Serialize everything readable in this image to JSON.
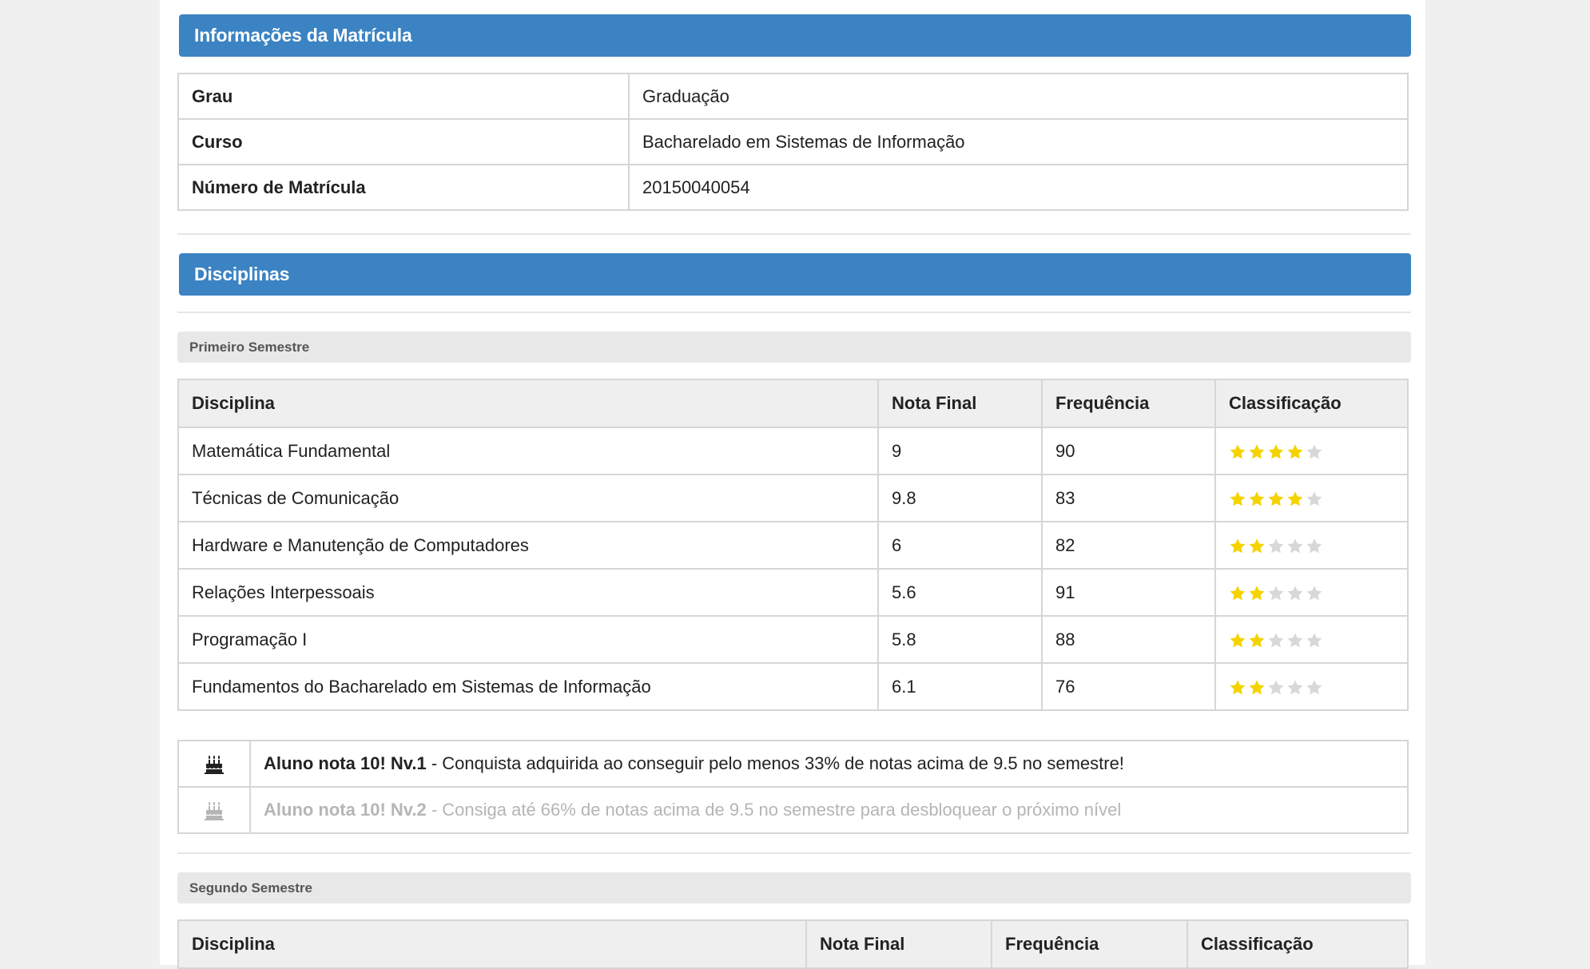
{
  "enrollment": {
    "title": "Informações da Matrícula",
    "rows": [
      {
        "label": "Grau",
        "value": "Graduação"
      },
      {
        "label": "Curso",
        "value": "Bacharelado em Sistemas de Informação"
      },
      {
        "label": "Número de Matrícula",
        "value": "20150040054"
      }
    ]
  },
  "disciplines": {
    "title": "Disciplinas",
    "columns": [
      "Disciplina",
      "Nota Final",
      "Frequência",
      "Classificação"
    ],
    "semesters": [
      {
        "label": "Primeiro Semestre",
        "rows": [
          {
            "name": "Matemática Fundamental",
            "grade": "9",
            "attendance": "90",
            "stars": 4
          },
          {
            "name": "Técnicas de Comunicação",
            "grade": "9.8",
            "attendance": "83",
            "stars": 4
          },
          {
            "name": "Hardware e Manutenção de Computadores",
            "grade": "6",
            "attendance": "82",
            "stars": 2
          },
          {
            "name": "Relações Interpessoais",
            "grade": "5.6",
            "attendance": "91",
            "stars": 2
          },
          {
            "name": "Programação I",
            "grade": "5.8",
            "attendance": "88",
            "stars": 2
          },
          {
            "name": "Fundamentos do Bacharelado em Sistemas de Informação",
            "grade": "6.1",
            "attendance": "76",
            "stars": 2
          }
        ],
        "achievements": [
          {
            "icon": "birthday-cake-icon",
            "title": "Aluno nota 10! Nv.1",
            "text": " - Conquista adquirida ao conseguir pelo menos 33% de notas acima de 9.5 no semestre!",
            "locked": false
          },
          {
            "icon": "birthday-cake-icon",
            "title": "Aluno nota 10! Nv.2",
            "text": " - Consiga até 66% de notas acima de 9.5 no semestre para desbloquear o próximo nível",
            "locked": true
          }
        ]
      },
      {
        "label": "Segundo Semestre"
      }
    ]
  },
  "colors": {
    "header_blue": "#3b83c3",
    "star_filled": "#f5d300",
    "star_empty": "#d8d8d8",
    "locked_text": "#b5b5b5"
  }
}
